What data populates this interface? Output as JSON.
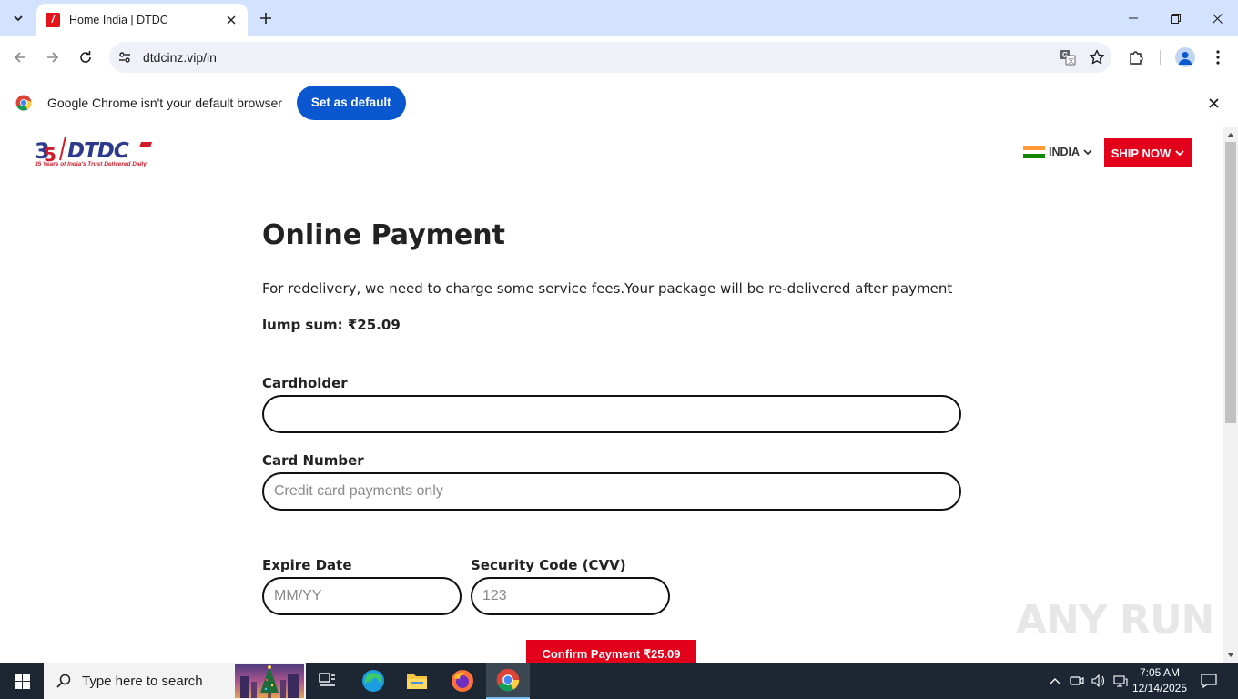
{
  "browser": {
    "tab_title": "Home India | DTDC",
    "url": "dtdcinz.vip/in",
    "infobar_text": "Google Chrome isn't your default browser",
    "infobar_button": "Set as default"
  },
  "site": {
    "logo_tagline": "35 Years of India's Trust Delivered Daily",
    "country": "INDIA",
    "ship_now": "SHIP NOW",
    "brand_color": "#e3001b"
  },
  "payment": {
    "title": "Online Payment",
    "description": "For redelivery, we need to charge some service fees.Your package will be re-delivered after payment",
    "amount_text": "lump sum: ₹25.09",
    "cardholder_label": "Cardholder",
    "cardholder_value": "",
    "card_number_label": "Card Number",
    "card_number_placeholder": "Credit card payments only",
    "expire_label": "Expire Date",
    "expire_placeholder": "MM/YY",
    "cvv_label": "Security Code (CVV)",
    "cvv_placeholder": "123",
    "confirm_button": "Confirm Payment ₹25.09"
  },
  "watermark": "ANY RUN",
  "taskbar": {
    "search_placeholder": "Type here to search",
    "time": "7:05 AM",
    "date": "12/14/2025"
  }
}
